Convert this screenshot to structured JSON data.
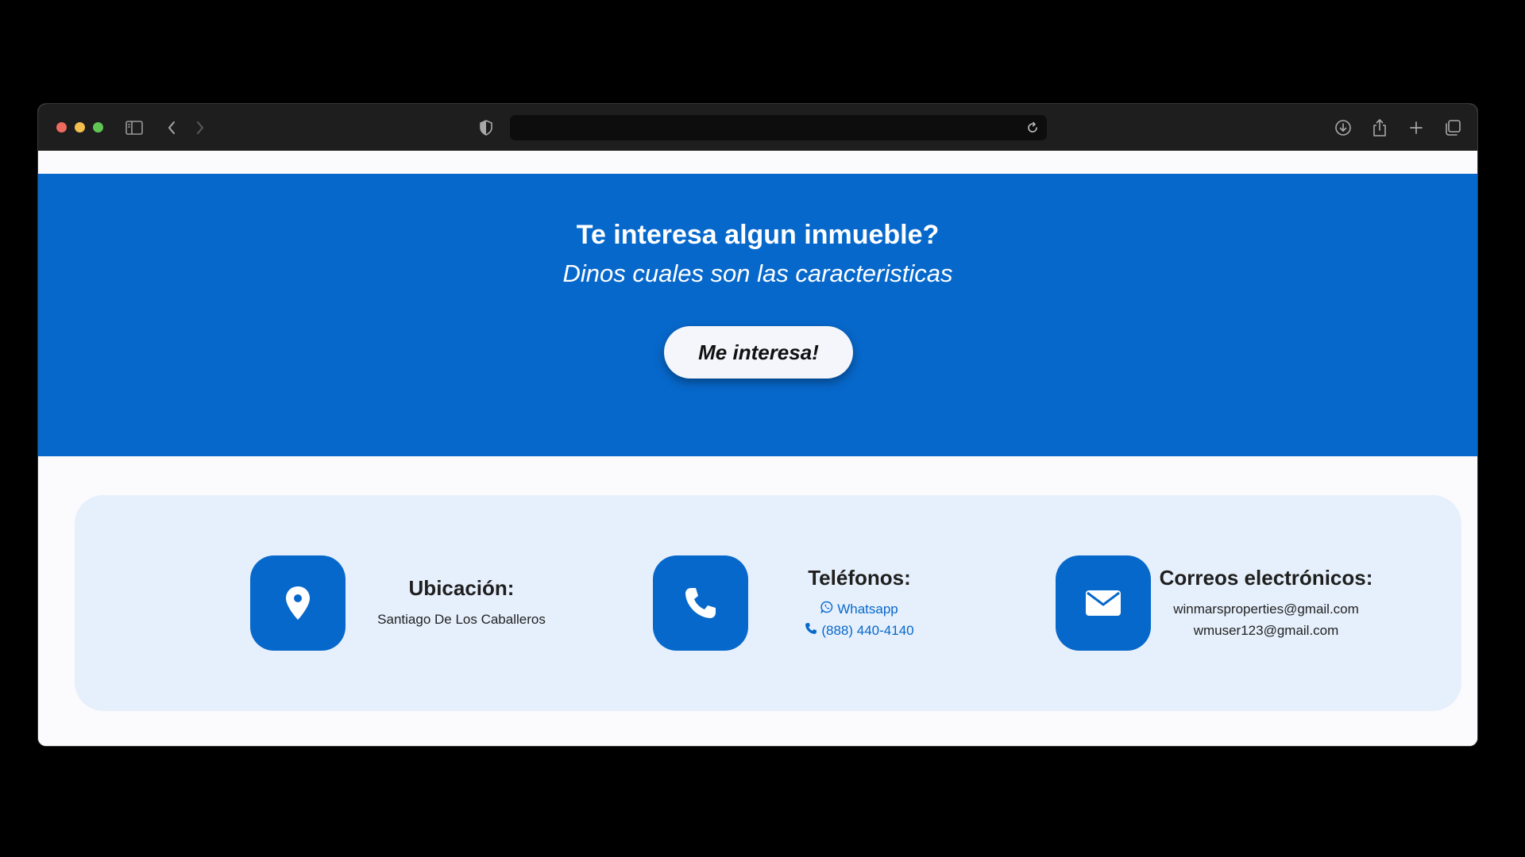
{
  "browser": {
    "address_value": "",
    "icons": [
      "sidebar-icon",
      "back-icon",
      "forward-icon",
      "shield-icon",
      "reload-icon",
      "download-icon",
      "share-icon",
      "new-tab-icon",
      "tabs-overview-icon"
    ]
  },
  "hero": {
    "title": "Te interesa algun inmueble?",
    "subtitle": "Dinos cuales son las caracteristicas",
    "cta_label": "Me interesa!",
    "background_color": "#0768cb"
  },
  "contact": {
    "location": {
      "icon": "map-pin-icon",
      "heading": "Ubicación:",
      "value": "Santiago De Los Caballeros"
    },
    "phones": {
      "icon": "phone-icon",
      "heading": "Teléfonos:",
      "whatsapp_label": "Whatsapp",
      "phone_number": "(888) 440-4140"
    },
    "emails": {
      "icon": "envelope-icon",
      "heading": "Correos electrónicos:",
      "addresses": [
        "winmarsproperties@gmail.com",
        "wmuser123@gmail.com"
      ]
    },
    "accent_color": "#0768cb",
    "card_color": "#e6f0fc"
  }
}
